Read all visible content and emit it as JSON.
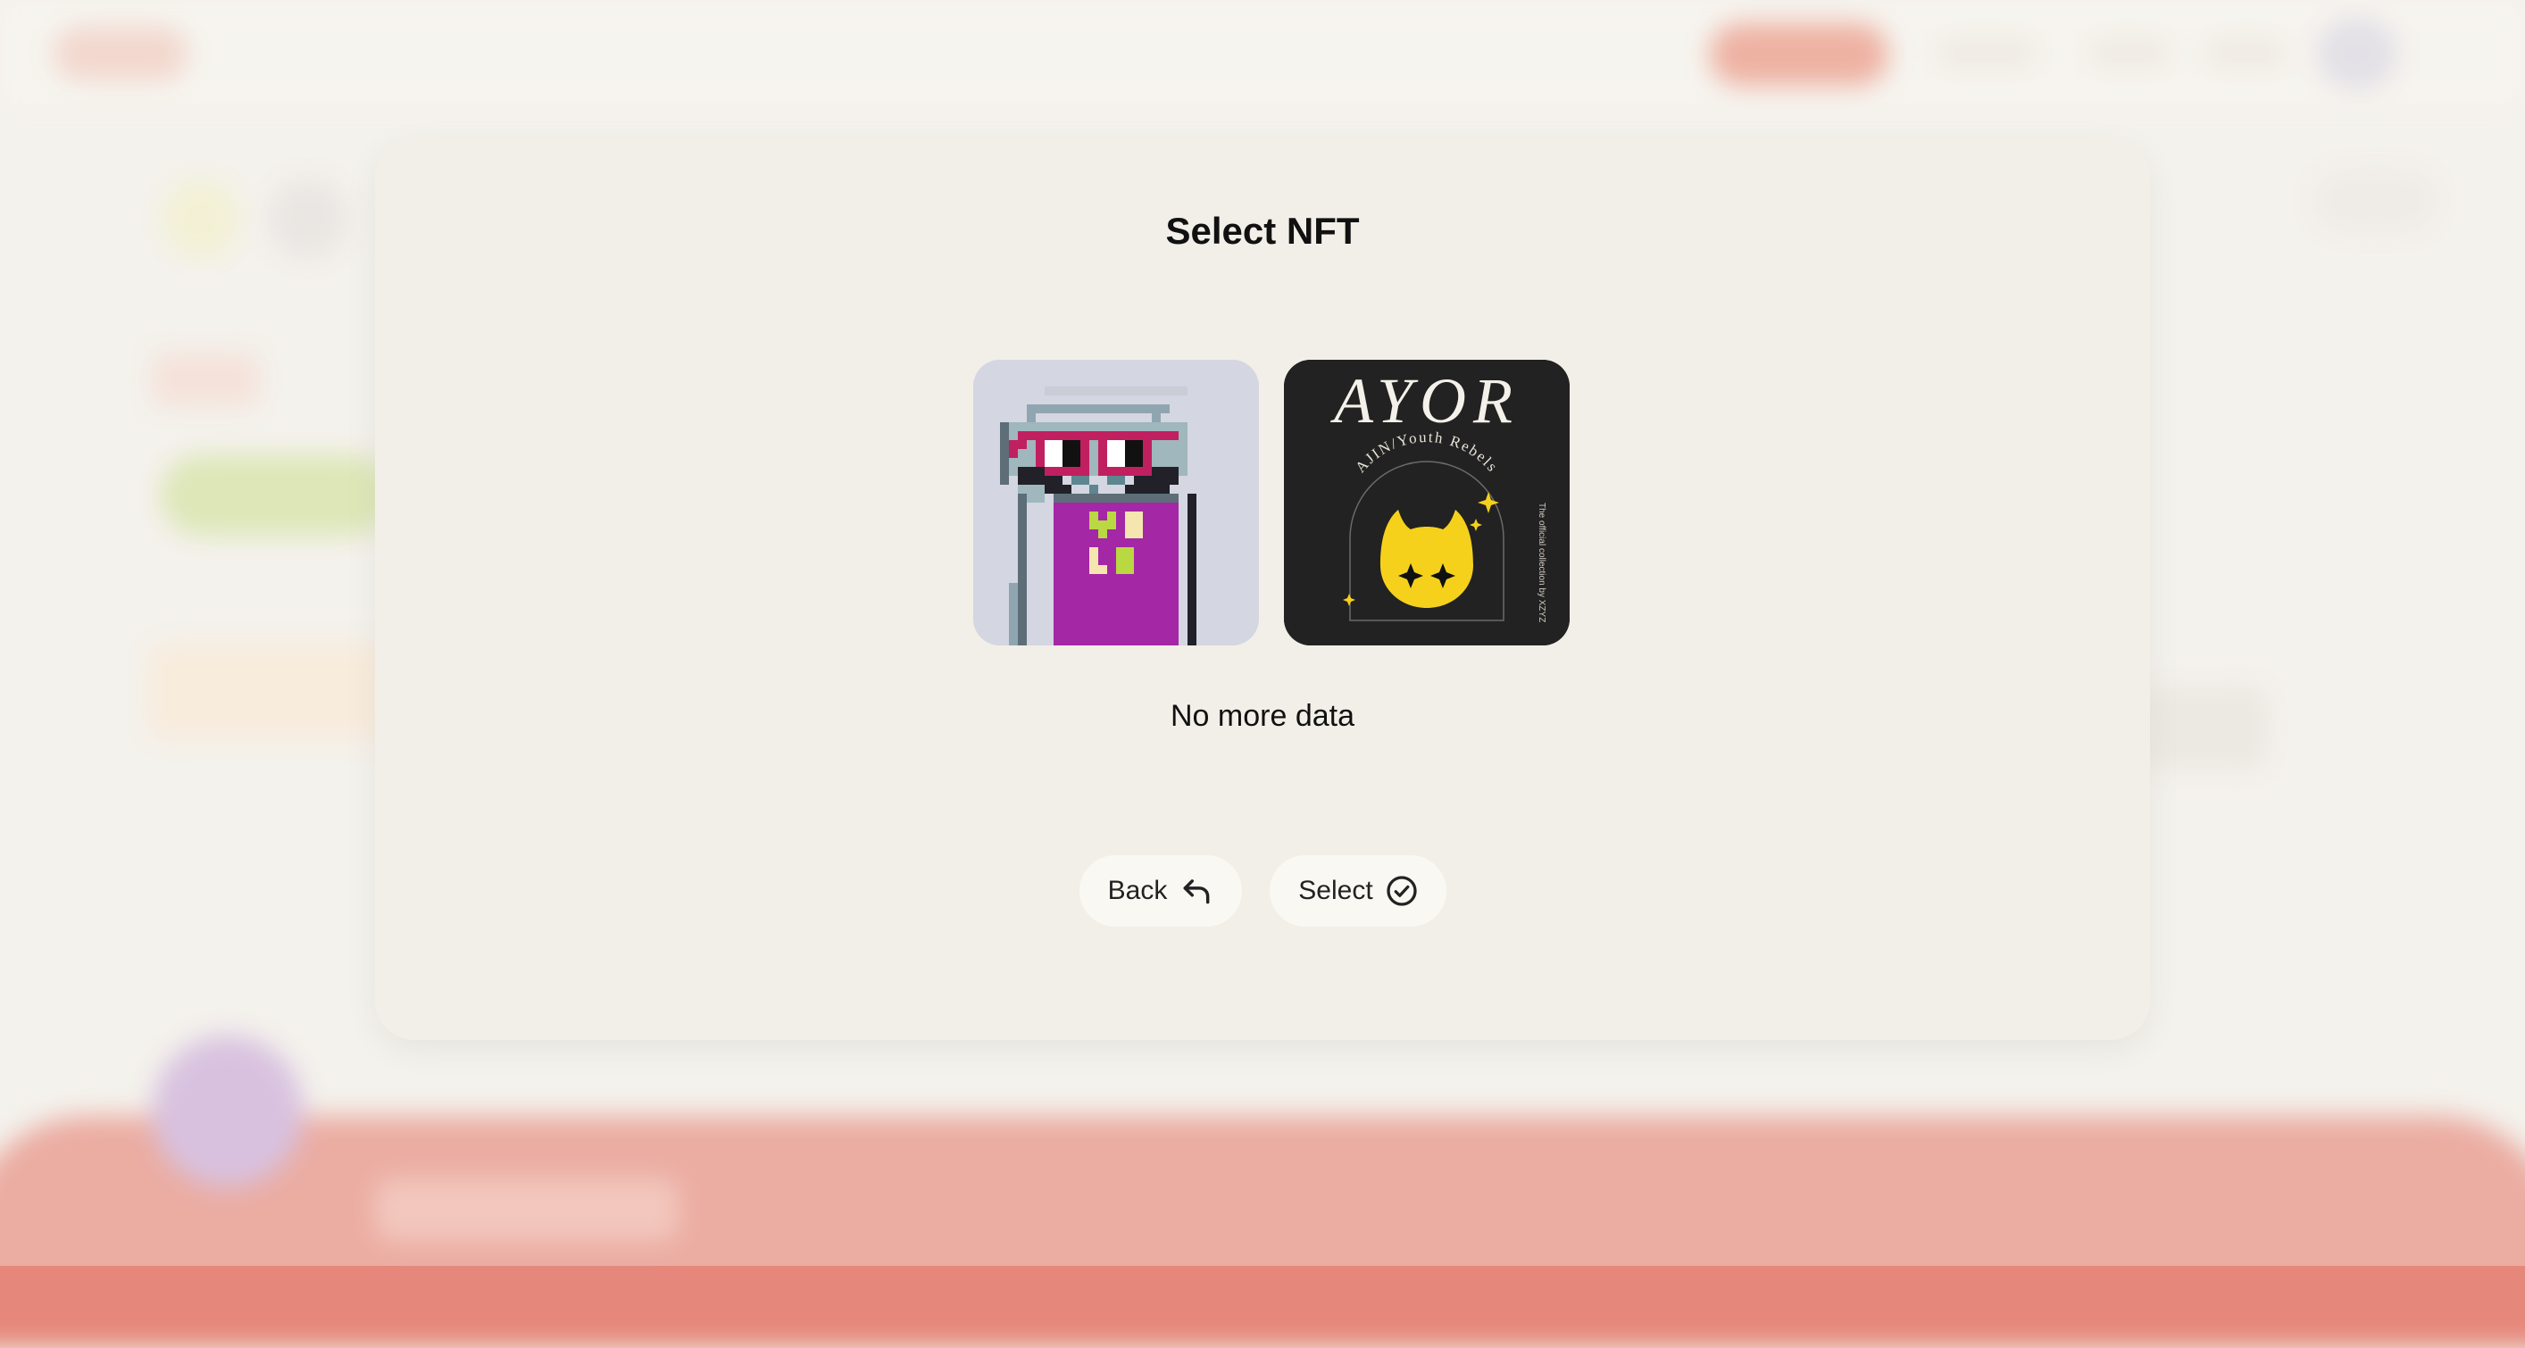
{
  "modal": {
    "title": "Select NFT",
    "empty_text": "No more data",
    "back_label": "Back",
    "select_label": "Select"
  },
  "nfts": [
    {
      "name": "punk-nft",
      "icon": "pixel-punk-image"
    },
    {
      "name": "ayor-nft",
      "icon": "ayor-cat-image",
      "title_text": "AYOR",
      "arc_text": "AJIN/Youth Rebels",
      "side_text": "The official collection by XZYZ"
    }
  ],
  "colors": {
    "modal_bg": "#f2efe8",
    "page_bg": "#f3f1ec",
    "button_bg": "#faf8f3",
    "accent_coral": "#e5877a",
    "nft_yellow": "#f6d11c",
    "punk_purple": "#a427a6"
  }
}
